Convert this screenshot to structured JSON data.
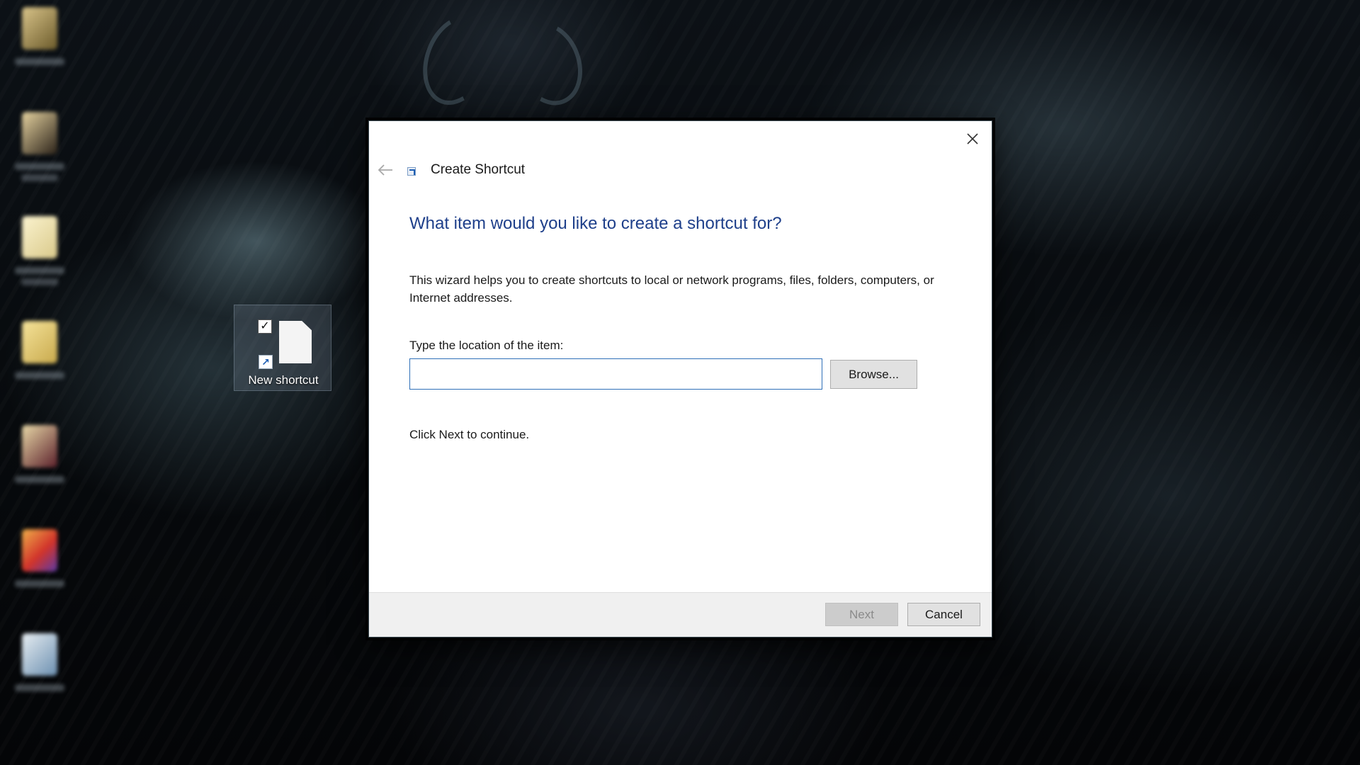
{
  "desktop": {
    "selected_icon": {
      "label": "New shortcut",
      "icon": "shortcut-file-icon"
    }
  },
  "dialog": {
    "title": "Create Shortcut",
    "heading": "What item would you like to create a shortcut for?",
    "description": "This wizard helps you to create shortcuts to local or network programs, files, folders, computers, or Internet addresses.",
    "location_label": "Type the location of the item:",
    "location_value": "",
    "browse_label": "Browse...",
    "continue_text": "Click Next to continue.",
    "next_label": "Next",
    "cancel_label": "Cancel",
    "icons": {
      "close": "close-icon",
      "back": "back-arrow-icon",
      "title": "shortcut-icon"
    }
  },
  "colors": {
    "heading": "#1e3f8a",
    "input_border": "#2e6fb8",
    "footer": "#f0f0f0",
    "disabled_button": "#cccccc"
  }
}
